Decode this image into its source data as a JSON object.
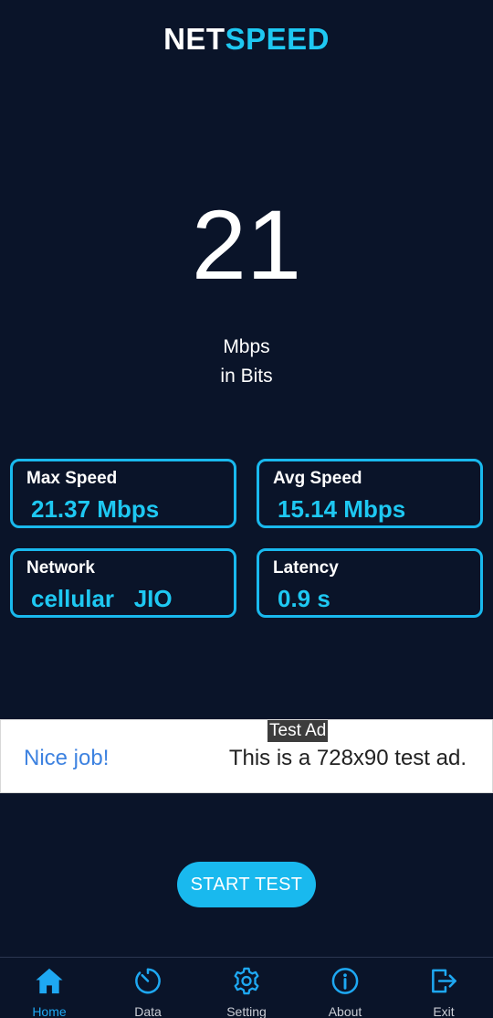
{
  "header": {
    "title_part1": "NET",
    "title_part2": "SPEED"
  },
  "speed": {
    "value": "21",
    "unit": "Mbps",
    "mode": "in Bits"
  },
  "stats": {
    "max": {
      "label": "Max Speed",
      "value": "21.37 Mbps"
    },
    "avg": {
      "label": "Avg Speed",
      "value": "15.14 Mbps"
    },
    "network": {
      "label": "Network",
      "value": "cellular   JIO"
    },
    "latency": {
      "label": "Latency",
      "value": "0.9 s"
    }
  },
  "ad": {
    "tag": "Test Ad",
    "left_text": "Nice job!",
    "right_text": "This is a 728x90 test ad."
  },
  "start_button": {
    "label": "START TEST"
  },
  "nav": {
    "active": "home",
    "items": [
      {
        "label": "Home",
        "icon": "home-icon"
      },
      {
        "label": "Data",
        "icon": "speedometer-icon"
      },
      {
        "label": "Setting",
        "icon": "gear-icon"
      },
      {
        "label": "About",
        "icon": "info-icon"
      },
      {
        "label": "Exit",
        "icon": "exit-icon"
      }
    ]
  },
  "colors": {
    "background": "#0a1429",
    "accent": "#1ec8f2",
    "nav_active": "#1ea8f2"
  }
}
